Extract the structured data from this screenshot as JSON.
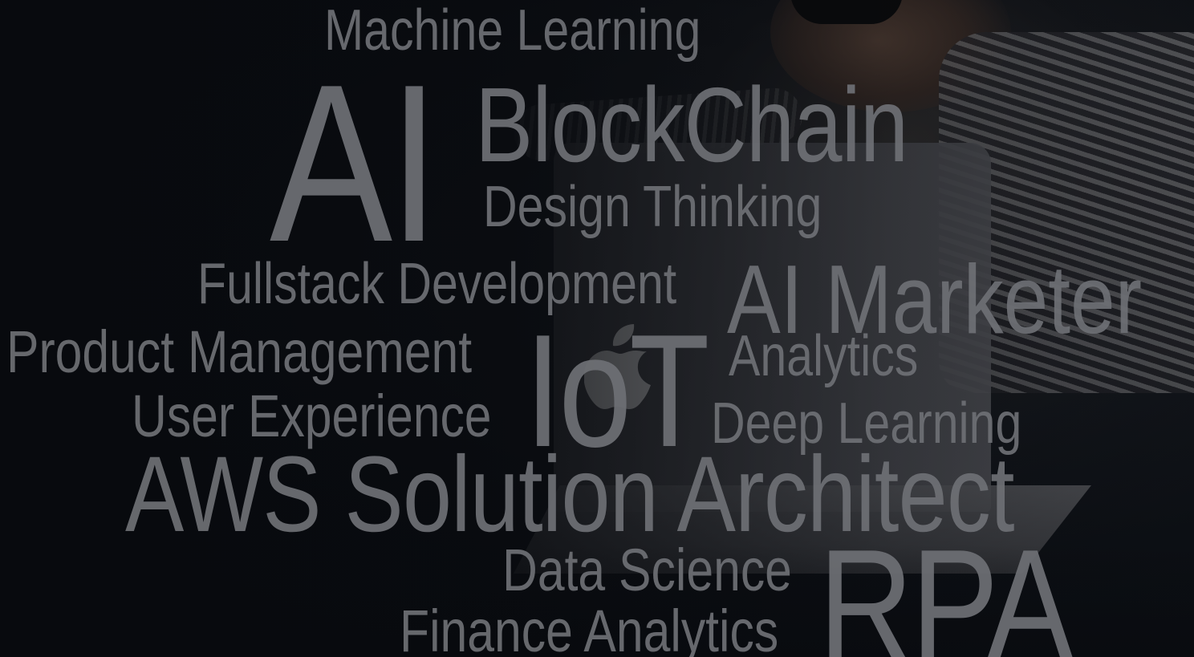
{
  "background": {
    "description_icon": "person-with-vr-headset-at-laptop",
    "laptop_logo_icon": "apple-logo-icon",
    "base_color": "#0b0e13",
    "word_color": "#6e7075"
  },
  "words": {
    "machine_learning": "Machine Learning",
    "ai": "AI",
    "blockchain": "BlockChain",
    "design_thinking": "Design Thinking",
    "fullstack_development": "Fullstack Development",
    "ai_marketer": "AI Marketer",
    "product_management": "Product Management",
    "iot": "IoT",
    "analytics": "Analytics",
    "user_experience": "User Experience",
    "deep_learning": "Deep Learning",
    "aws_solution_architect": "AWS Solution Architect",
    "data_science": "Data Science",
    "rpa": "RPA",
    "finance_analytics": "Finance Analytics"
  }
}
